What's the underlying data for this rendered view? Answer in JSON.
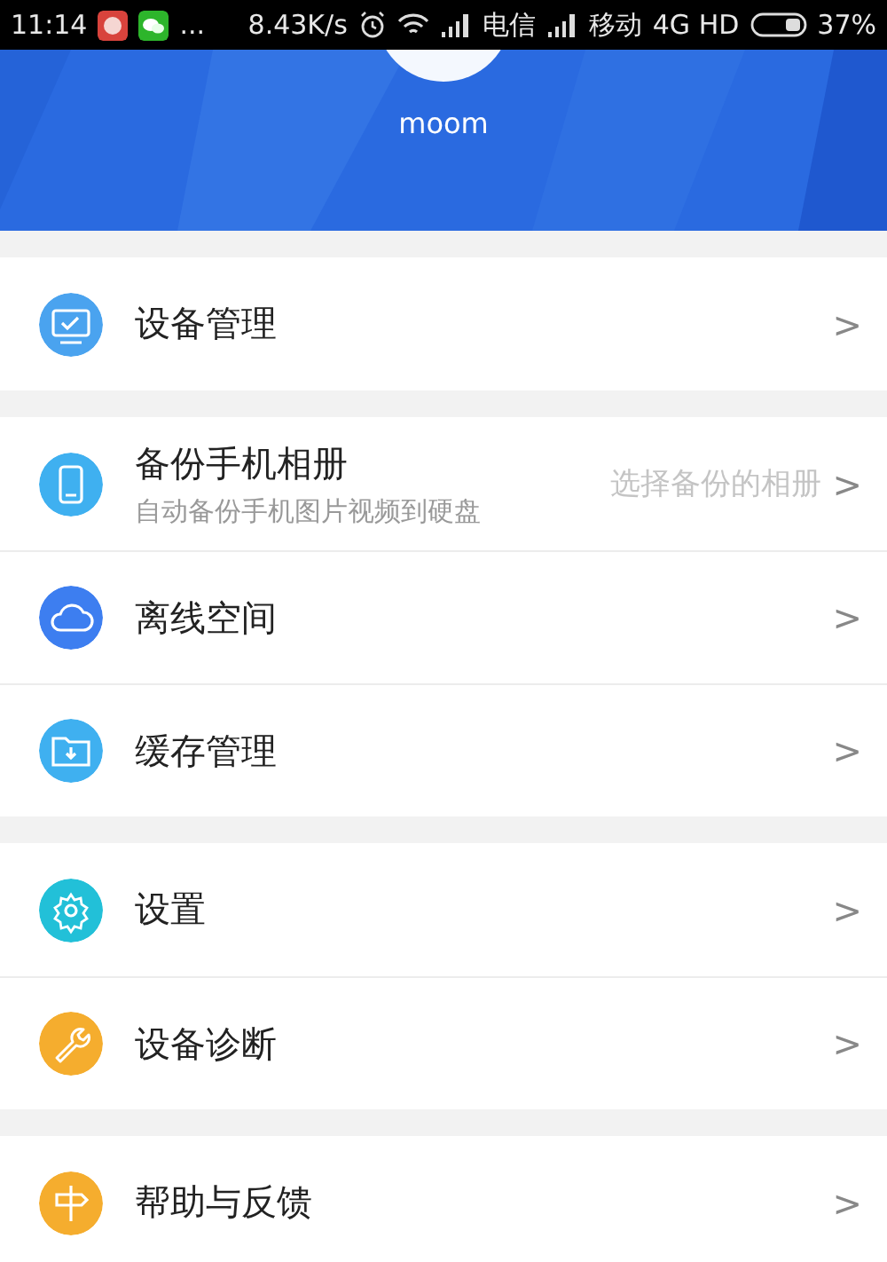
{
  "status_bar": {
    "time": "11:14",
    "more": "...",
    "speed": "8.43K/s",
    "carrier_1": "电信",
    "carrier_2": "移动",
    "network": "4G HD",
    "battery_percent": "37%"
  },
  "header": {
    "username": "moom"
  },
  "groups": [
    {
      "items": [
        {
          "kind": "monitor",
          "color": "#4aa3ef",
          "title": "设备管理",
          "chevron": ">"
        }
      ]
    },
    {
      "items": [
        {
          "kind": "phone",
          "color": "#3fb0f0",
          "title": "备份手机相册",
          "subtitle": "自动备份手机图片视频到硬盘",
          "hint": "选择备份的相册",
          "chevron": ">"
        },
        {
          "kind": "cloud",
          "color": "#3d7ef0",
          "title": "离线空间",
          "chevron": ">"
        },
        {
          "kind": "folder",
          "color": "#3fb0f0",
          "title": "缓存管理",
          "chevron": ">"
        }
      ]
    },
    {
      "items": [
        {
          "kind": "gear",
          "color": "#22c0d8",
          "title": "设置",
          "chevron": ">"
        },
        {
          "kind": "wrench",
          "color": "#f5ad2e",
          "title": "设备诊断",
          "chevron": ">"
        }
      ]
    },
    {
      "items": [
        {
          "kind": "signpost",
          "color": "#f5ad2e",
          "title": "帮助与反馈",
          "chevron": ">"
        }
      ]
    }
  ]
}
